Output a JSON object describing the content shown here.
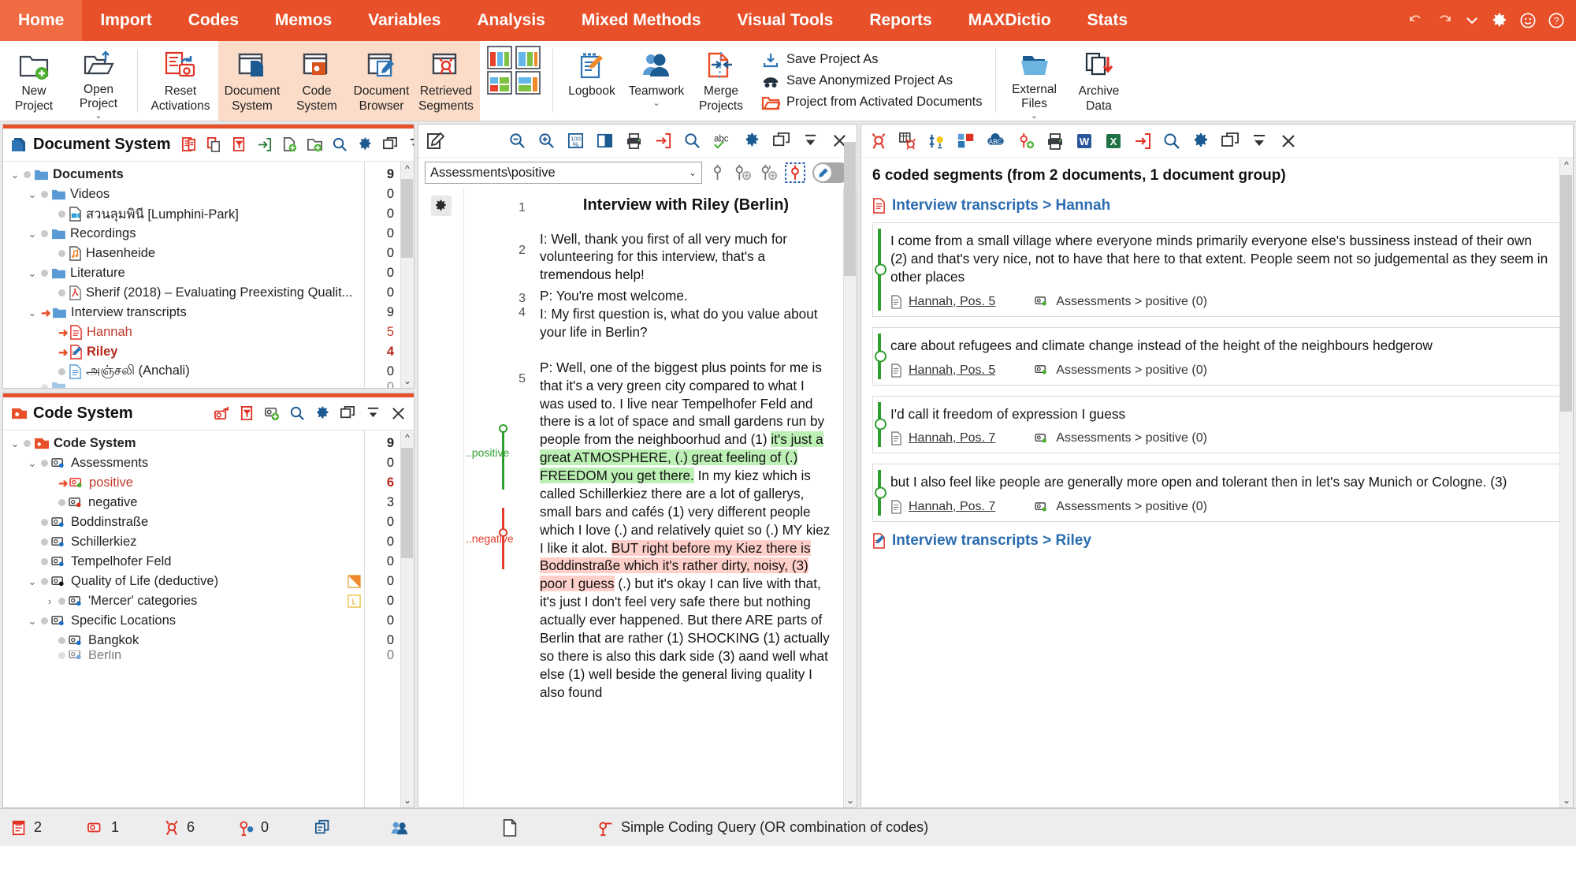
{
  "colors": {
    "brand": "#e8502a",
    "brand_active": "#f06a42",
    "highlight_group": "#fbdcc8",
    "link": "#2b6cb0",
    "code_green": "#2e9f2e",
    "code_red": "#e23b2a"
  },
  "ribbon": {
    "tabs": [
      {
        "label": "Home",
        "active": true
      },
      {
        "label": "Import",
        "active": false
      },
      {
        "label": "Codes",
        "active": false
      },
      {
        "label": "Memos",
        "active": false
      },
      {
        "label": "Variables",
        "active": false
      },
      {
        "label": "Analysis",
        "active": false
      },
      {
        "label": "Mixed Methods",
        "active": false
      },
      {
        "label": "Visual Tools",
        "active": false
      },
      {
        "label": "Reports",
        "active": false
      },
      {
        "label": "MAXDictio",
        "active": false
      },
      {
        "label": "Stats",
        "active": false
      }
    ],
    "right_icons": [
      "undo-icon",
      "redo-icon",
      "chevron-down-icon",
      "gear-icon",
      "smiley-icon",
      "help-icon"
    ],
    "groups": {
      "project": [
        {
          "line1": "New",
          "line2": "Project",
          "icon": "new-project-icon",
          "caret": false
        },
        {
          "line1": "Open",
          "line2": "Project",
          "icon": "open-project-icon",
          "caret": true
        }
      ],
      "reset": [
        {
          "line1": "Reset",
          "line2": "Activations",
          "icon": "reset-activations-icon",
          "caret": false
        }
      ],
      "windows": [
        {
          "line1": "Document",
          "line2": "System",
          "icon": "document-system-icon",
          "caret": false
        },
        {
          "line1": "Code",
          "line2": "System",
          "icon": "code-system-icon",
          "caret": false
        },
        {
          "line1": "Document",
          "line2": "Browser",
          "icon": "document-browser-icon",
          "caret": false
        },
        {
          "line1": "Retrieved",
          "line2": "Segments",
          "icon": "retrieved-segments-icon",
          "caret": false
        }
      ],
      "layout": [
        {
          "line1": "",
          "line2": "",
          "icon": "window-layout-icon",
          "caret": false
        }
      ],
      "tools": [
        {
          "line1": "Logbook",
          "line2": "",
          "icon": "logbook-icon",
          "caret": false
        },
        {
          "line1": "Teamwork",
          "line2": "",
          "icon": "teamwork-icon",
          "caret": true
        },
        {
          "line1": "Merge",
          "line2": "Projects",
          "icon": "merge-projects-icon",
          "caret": false
        }
      ],
      "save_menu": [
        {
          "label": "Save Project As",
          "icon": "save-project-as-icon"
        },
        {
          "label": "Save Anonymized Project As",
          "icon": "save-anonymized-icon"
        },
        {
          "label": "Project from Activated Documents",
          "icon": "project-from-activated-icon"
        }
      ],
      "files": [
        {
          "line1": "External",
          "line2": "Files",
          "icon": "external-files-icon",
          "caret": true
        },
        {
          "line1": "Archive",
          "line2": "Data",
          "icon": "archive-data-icon",
          "caret": false
        }
      ]
    }
  },
  "document_system": {
    "title": "Document System",
    "tools": [
      "open-memo-icon",
      "copy-documents-icon",
      "filter-documents-icon",
      "import-document-icon",
      "new-document-icon",
      "new-document-group-icon",
      "search-icon",
      "gear-icon",
      "undock-icon",
      "collapse-icon",
      "close-icon"
    ],
    "nodes": [
      {
        "label": "Documents",
        "indent": 0,
        "twisty": "v",
        "icon": "folder-icon",
        "bold": true,
        "count": "9",
        "activated": false,
        "style": "bold"
      },
      {
        "label": "Videos",
        "indent": 1,
        "twisty": "v",
        "icon": "folder-icon",
        "count": "0",
        "activated": false,
        "style": ""
      },
      {
        "label": "สวนลุมพินี [Lumphini-Park]",
        "indent": 2,
        "twisty": "",
        "icon": "video-doc-icon",
        "count": "0",
        "activated": false,
        "style": ""
      },
      {
        "label": "Recordings",
        "indent": 1,
        "twisty": "v",
        "icon": "folder-icon",
        "count": "0",
        "activated": false,
        "style": ""
      },
      {
        "label": "Hasenheide",
        "indent": 2,
        "twisty": "",
        "icon": "audio-doc-icon",
        "count": "0",
        "activated": false,
        "style": ""
      },
      {
        "label": "Literature",
        "indent": 1,
        "twisty": "v",
        "icon": "folder-icon",
        "count": "0",
        "activated": false,
        "style": ""
      },
      {
        "label": "Sherif (2018) – Evaluating Preexisting Qualit...",
        "indent": 2,
        "twisty": "",
        "icon": "pdf-doc-icon",
        "count": "0",
        "activated": false,
        "style": ""
      },
      {
        "label": "Interview transcripts",
        "indent": 1,
        "twisty": "v",
        "icon": "folder-icon",
        "count": "9",
        "activated": true,
        "style": ""
      },
      {
        "label": "Hannah",
        "indent": 2,
        "twisty": "",
        "icon": "text-doc-red-icon",
        "count": "5",
        "activated": true,
        "style": "red"
      },
      {
        "label": "Riley",
        "indent": 2,
        "twisty": "",
        "icon": "text-doc-edit-icon",
        "count": "4",
        "activated": true,
        "style": "redb"
      },
      {
        "label": "அஞ்சலி (Anchali)",
        "indent": 2,
        "twisty": "",
        "icon": "text-doc-icon",
        "count": "0",
        "activated": false,
        "style": ""
      },
      {
        "label": "",
        "indent": 1,
        "twisty": "v",
        "icon": "folder-icon",
        "count": "0",
        "activated": false,
        "style": ""
      }
    ]
  },
  "code_system": {
    "title": "Code System",
    "tools": [
      "activate-codes-icon",
      "filter-codes-icon",
      "new-code-icon",
      "search-icon",
      "gear-icon",
      "undock-icon",
      "collapse-icon",
      "close-icon"
    ],
    "nodes": [
      {
        "label": "Code System",
        "indent": 0,
        "twisty": "v",
        "icon": "codesystem-root-icon",
        "count": "9",
        "activated": false,
        "style": "bold",
        "memo": ""
      },
      {
        "label": "Assessments",
        "indent": 1,
        "twisty": "v",
        "icon": "code-blue-icon",
        "count": "0",
        "activated": false,
        "style": "",
        "memo": ""
      },
      {
        "label": "positive",
        "indent": 2,
        "twisty": "",
        "icon": "code-green-icon",
        "count": "6",
        "activated": true,
        "style": "red",
        "memo": ""
      },
      {
        "label": "negative",
        "indent": 2,
        "twisty": "",
        "icon": "code-red-icon",
        "count": "3",
        "activated": false,
        "style": "",
        "memo": ""
      },
      {
        "label": "Boddinstraße",
        "indent": 1,
        "twisty": "",
        "icon": "code-blue-icon",
        "count": "0",
        "activated": false,
        "style": "",
        "memo": ""
      },
      {
        "label": "Schillerkiez",
        "indent": 1,
        "twisty": "",
        "icon": "code-blue-icon",
        "count": "0",
        "activated": false,
        "style": "",
        "memo": ""
      },
      {
        "label": "Tempelhofer Feld",
        "indent": 1,
        "twisty": "",
        "icon": "code-blue-icon",
        "count": "0",
        "activated": false,
        "style": "",
        "memo": ""
      },
      {
        "label": "Quality of Life (deductive)",
        "indent": 1,
        "twisty": "v",
        "icon": "code-black-icon",
        "count": "0",
        "activated": false,
        "style": "",
        "memo": "memo-orange-icon"
      },
      {
        "label": "'Mercer' categories",
        "indent": 2,
        "twisty": ">",
        "icon": "code-blue-icon",
        "count": "0",
        "activated": false,
        "style": "",
        "memo": "memo-yellow-icon"
      },
      {
        "label": "Specific Locations",
        "indent": 1,
        "twisty": "v",
        "icon": "code-blue-icon",
        "count": "0",
        "activated": false,
        "style": "",
        "memo": ""
      },
      {
        "label": "Bangkok",
        "indent": 2,
        "twisty": "",
        "icon": "code-blue-icon",
        "count": "0",
        "activated": false,
        "style": "",
        "memo": ""
      },
      {
        "label": "Berlin",
        "indent": 2,
        "twisty": "",
        "icon": "code-blue-icon",
        "count": "0",
        "activated": false,
        "style": "",
        "memo": ""
      }
    ]
  },
  "document_browser": {
    "tools_left": [
      "edit-mode-icon"
    ],
    "tools_right": [
      "zoom-out-icon",
      "zoom-in-icon",
      "zoom-100-icon",
      "split-view-icon",
      "print-icon",
      "export-icon",
      "search-icon",
      "spellcheck-icon",
      "gear-icon",
      "undock-icon",
      "collapse-icon",
      "close-icon"
    ],
    "code_selector": {
      "value": "Assessments\\positive",
      "placeholder": "Select a code"
    },
    "code_tools": [
      "code-inline-icon",
      "code-new-icon",
      "code-with-new-icon",
      "highlight-code-icon"
    ],
    "toggle_icon": "pencil-toggle-icon",
    "doc_title": "Interview with Riley (Berlin)",
    "paragraphs": [
      {
        "num": "1",
        "type": "title",
        "text": "Interview with Riley (Berlin)"
      },
      {
        "num": "2",
        "type": "body",
        "text": "I: Well, thank you first of all very much for volunteering for this interview, that's a tremendous help!"
      },
      {
        "num": "3",
        "type": "body",
        "text": "P: You're most welcome."
      },
      {
        "num": "4",
        "type": "body",
        "text": "I: My first question is, what do you value about your life in Berlin?"
      },
      {
        "num": "5",
        "type": "body_rich",
        "text": "P: Well, one of the biggest plus points for me is that it's a very green city compared to what I was used to. I live near Tempelhofer Feld and there is a lot of space and small gardens run by people from the neighboorhud and (1) it's just a great ATMOSPHERE, (.) great feeling of (.) FREEDOM you get there. In my kiez which is called Schillerkiez there are a lot of gallerys, small bars and cafés (1) very different people which I love (.) and relatively quiet so (.) MY kiez I like it alot. BUT right before my Kiez there is Boddinstraße which it's rather dirty, noisy, (3) poor I guess (.) but it's okay I can live with that, it's just I don't feel very safe there but nothing actually ever happened. But there ARE parts of Berlin that are rather (1) SHOCKING (1) actually so there is also this dark side (3) aand well what else (1) well beside the general living quality I also found"
      }
    ],
    "code_labels": [
      {
        "label": "..positive",
        "color": "#2e9f2e"
      },
      {
        "label": "..negative",
        "color": "#e23b2a"
      }
    ]
  },
  "retrieved_segments": {
    "tools": [
      "retrieve-icon",
      "segment-matrix-icon",
      "smart-coding-icon",
      "summary-grid-icon",
      "abc-cloud-icon",
      "new-segment-icon",
      "print-icon",
      "export-word-icon",
      "export-excel-icon",
      "export-icon",
      "search-icon",
      "gear-icon",
      "undock-icon",
      "collapse-icon",
      "close-icon"
    ],
    "count_text": "6 coded segments (from 2 documents, 1 document group)",
    "groups": [
      {
        "title": "Interview transcripts > Hannah",
        "icon": "text-doc-icon",
        "segments": [
          {
            "text": "I come from a small village where everyone minds primarily everyone else's bussiness instead of their own (2) and that's very nice, not to have that here to that extent. People seem not so judgemental as they seem in other places",
            "source": "Hannah, Pos. 5",
            "code": "Assessments > positive (0)",
            "color": "#2e9f2e"
          },
          {
            "text": "care about refugees and climate change instead of the height of the neighbours hedgerow",
            "source": "Hannah, Pos. 5",
            "code": "Assessments > positive (0)",
            "color": "#2e9f2e"
          },
          {
            "text": "I'd call it freedom of expression I guess",
            "source": "Hannah, Pos. 7",
            "code": "Assessments > positive (0)",
            "color": "#2e9f2e"
          },
          {
            "text": "but I also feel like people are generally more open and tolerant then in let's say Munich or Cologne. (3)",
            "source": "Hannah, Pos. 7",
            "code": "Assessments > positive (0)",
            "color": "#2e9f2e"
          }
        ]
      },
      {
        "title": "Interview transcripts > Riley",
        "icon": "text-doc-edit-icon",
        "segments": []
      }
    ]
  },
  "status_bar": {
    "items": [
      {
        "icon": "documents-count-icon",
        "value": "2"
      },
      {
        "icon": "codes-count-icon",
        "value": "1"
      },
      {
        "icon": "segments-count-icon",
        "value": "6"
      },
      {
        "icon": "memos-count-icon",
        "value": "0"
      },
      {
        "icon": "variables-icon",
        "value": ""
      },
      {
        "icon": "teamwork-status-icon",
        "value": ""
      },
      {
        "icon": "doc-status-icon",
        "value": ""
      }
    ],
    "query": {
      "icon": "coding-query-icon",
      "text": "Simple Coding Query (OR combination of codes)"
    }
  }
}
